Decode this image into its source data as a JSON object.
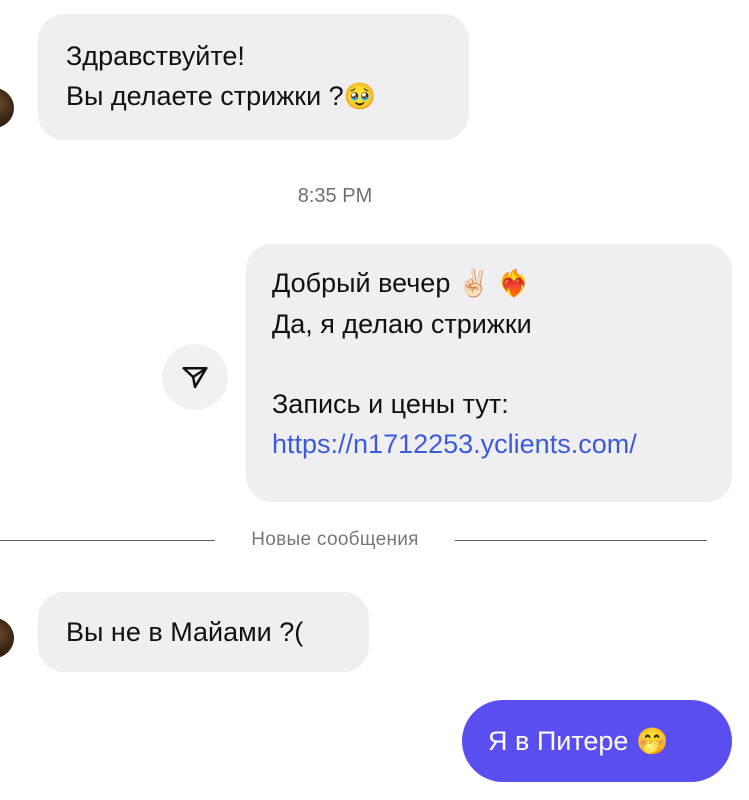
{
  "messages": {
    "incoming_1": {
      "line_1": "Здравствуйте!",
      "line_2": "Вы делаете стрижки ?",
      "emoji": "🥹",
      "emoji_icon": "pleading-face-icon"
    },
    "timestamp": "8:35 PM",
    "outgoing_1": {
      "line_1": "Добрый вечер",
      "emoji_1": "✌🏻",
      "emoji_1_icon": "victory-hand-icon",
      "emoji_2": "❤️‍🔥",
      "emoji_2_icon": "heart-on-fire-icon",
      "line_2": "Да, я делаю стрижки",
      "line_3": "Запись и цены тут:",
      "link": "https://n1712253.yclients.com/"
    },
    "divider_label": "Новые сообщения",
    "incoming_2": {
      "text": "Вы не в Майами ?("
    },
    "outgoing_2": {
      "text": "Я в Питере",
      "emoji": "🤭",
      "emoji_icon": "face-with-hand-over-mouth-icon"
    }
  },
  "colors": {
    "incoming_bubble": "#efeff2",
    "outgoing_accent": "#5b4ef1",
    "link": "#3b5bdb"
  },
  "icons": {
    "share_button": "paper-plane-icon",
    "sender_avatar": "avatar"
  }
}
